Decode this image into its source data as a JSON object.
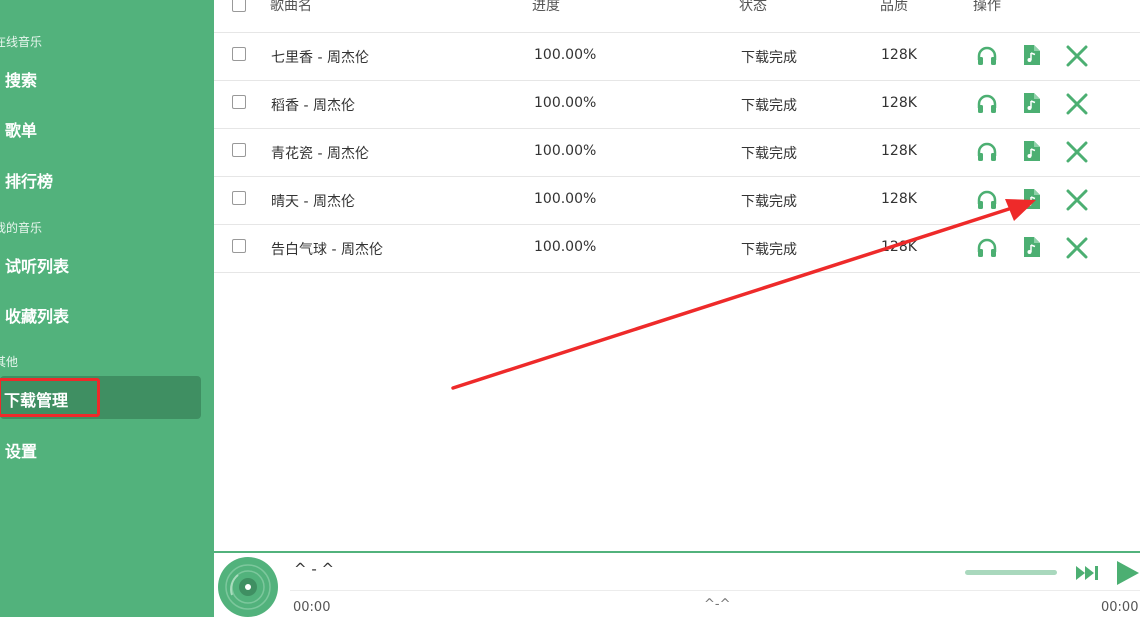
{
  "sidebar": {
    "online_music": "在线音乐",
    "search": "搜索",
    "playlists": "歌单",
    "charts": "排行榜",
    "my_music": "我的音乐",
    "trial_list": "试听列表",
    "favorites": "收藏列表",
    "other": "其他",
    "downloads": "下载管理",
    "settings": "设置"
  },
  "table": {
    "headers": {
      "song": "歌曲名",
      "progress": "进度",
      "status": "状态",
      "quality": "品质",
      "actions": "操作"
    },
    "rows": [
      {
        "song": "七里香 - 周杰伦",
        "progress": "100.00%",
        "status": "下载完成",
        "quality": "128K"
      },
      {
        "song": "稻香 - 周杰伦",
        "progress": "100.00%",
        "status": "下载完成",
        "quality": "128K"
      },
      {
        "song": "青花瓷 - 周杰伦",
        "progress": "100.00%",
        "status": "下载完成",
        "quality": "128K"
      },
      {
        "song": "晴天 - 周杰伦",
        "progress": "100.00%",
        "status": "下载完成",
        "quality": "128K"
      },
      {
        "song": "告白气球 - 周杰伦",
        "progress": "100.00%",
        "status": "下载完成",
        "quality": "128K"
      }
    ]
  },
  "player": {
    "title": "^ - ^",
    "time_current": "00:00",
    "artist": "^-^",
    "time_total": "00:00"
  },
  "icons": {
    "listen": "headphones-icon",
    "file": "music-file-icon",
    "delete": "close-icon",
    "next": "next-track-icon",
    "play": "play-icon",
    "disc": "vinyl-disc-icon"
  },
  "colors": {
    "sidebar": "#52b27c",
    "active": "#3f8f62",
    "accent": "#4caf72",
    "highlight": "#ee2a2a"
  }
}
